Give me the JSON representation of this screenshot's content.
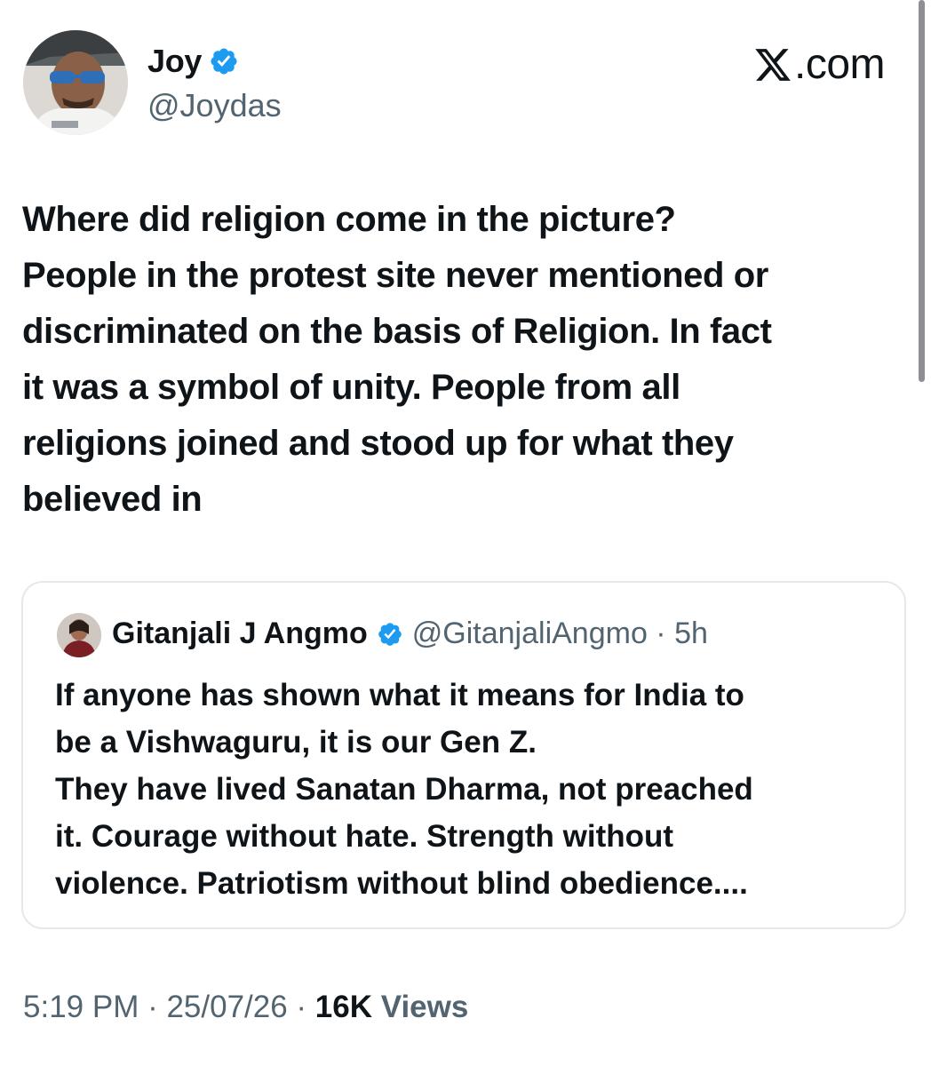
{
  "author": {
    "name": "Joy",
    "handle": "@Joydas",
    "verified_color": "#1d9bf0"
  },
  "site_label": ".com",
  "tweet": {
    "text": "Where did religion come in the picture?\nPeople in the protest site never mentioned or\ndiscriminated on the basis of Religion. In fact\nit was a symbol of unity. People from all\nreligions joined and stood up for what they\nbelieved in"
  },
  "quote": {
    "name": "Gitanjali J Angmo",
    "handle_time": "@GitanjaliAngmo · 5h",
    "text": "If anyone has shown what it means for India to\nbe a Vishwaguru, it is our Gen Z.\nThey have lived Sanatan Dharma, not preached\nit. Courage without hate. Strength without\nviolence. Patriotism without blind obedience...."
  },
  "footer": {
    "time_date": "5:19 PM · 25/07/26 · ",
    "views_count": "16K",
    "views_label": " Views"
  },
  "icons": {
    "verified": "verified-badge-icon",
    "x_logo": "x-logo-icon"
  }
}
